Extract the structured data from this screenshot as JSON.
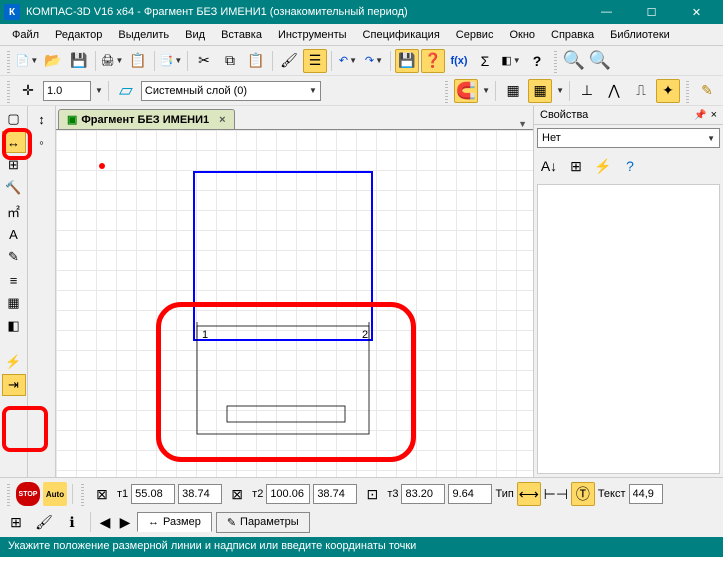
{
  "titlebar": {
    "app_icon_letter": "К",
    "title": "КОМПАС-3D V16  x64 - Фрагмент БЕЗ ИМЕНИ1 (ознакомительный период)"
  },
  "menubar": {
    "file": "Файл",
    "editor": "Редактор",
    "highlight": "Выделить",
    "view": "Вид",
    "insert": "Вставка",
    "tools": "Инструменты",
    "spec": "Спецификация",
    "service": "Сервис",
    "window": "Окно",
    "help": "Справка",
    "libs": "Библиотеки"
  },
  "toolbar1": {
    "new_icon": "📄",
    "open_icon": "📂",
    "save_icon": "💾",
    "print_icon": "🖨",
    "preview_icon": "📋",
    "props_icon": "📑",
    "cut_icon": "✂",
    "copy_icon": "⧉",
    "paste_icon": "📋",
    "brush_icon": "🖌",
    "params_icon": "☰",
    "undo_icon": "↶",
    "redo_icon": "↷",
    "store1_icon": "💾",
    "store2_icon": "❓",
    "fx_label": "f(x)",
    "var_icon": "Σ",
    "msg_icon": "◧",
    "help_icon": "?",
    "zoom_in_icon": "🔍",
    "zoom_out_icon": "🔍"
  },
  "toolbar2": {
    "cross_icon": "✛",
    "scale_value": "1.0",
    "layers_icon": "▱",
    "layer_name": "Системный слой (0)",
    "magnet_icon": "🧲",
    "grid_icon": "▦",
    "snap1": "⊥",
    "snap2": "⋀",
    "snap3": "⎍",
    "snap4": "✦",
    "edit_icon": "✎"
  },
  "doc_tab": {
    "icon": "▣",
    "label": "Фрагмент БЕЗ ИМЕНИ1",
    "close": "×"
  },
  "left_tools": {
    "t1": "▢",
    "t2": "↔",
    "t3": "⊞",
    "t4": "🔨",
    "t5": "㎡",
    "t6": "A",
    "t7": "✎",
    "t8": "≡",
    "t9": "▦",
    "t10": "◧",
    "t11": "⚡",
    "t12": "⇥"
  },
  "left_tools2": {
    "a1": "↕",
    "a2": "◦"
  },
  "canvas": {
    "label1": "1",
    "label2": "2"
  },
  "props": {
    "title": "Свойства",
    "panel_select": "Нет",
    "sort_icon": "A↓",
    "cat_icon": "⊞",
    "filter_icon": "⚡",
    "q_icon": "?"
  },
  "bottom": {
    "stop_icon": "STOP",
    "auto_icon": "Auto",
    "t1_label": "т1",
    "t1_x": "55.08",
    "t1_y": "38.74",
    "t2_label": "т2",
    "t2_x": "100.06",
    "t2_y": "38.74",
    "t3_label": "т3",
    "t3_x": "83.20",
    "t3_y": "9.64",
    "type_label": "Тип",
    "text_label": "Текст",
    "text_value": "44,9",
    "grid_icon": "⊞",
    "brush_icon": "🖌",
    "info_icon": "ℹ",
    "nav_prev": "◀",
    "nav_next": "▶",
    "tab1": "Размер",
    "tab2": "Параметры",
    "tab1_icon": "↔",
    "tab2_icon": "✎"
  },
  "statusbar": {
    "text": "Укажите положение размерной линии и надписи или введите координаты точки"
  }
}
